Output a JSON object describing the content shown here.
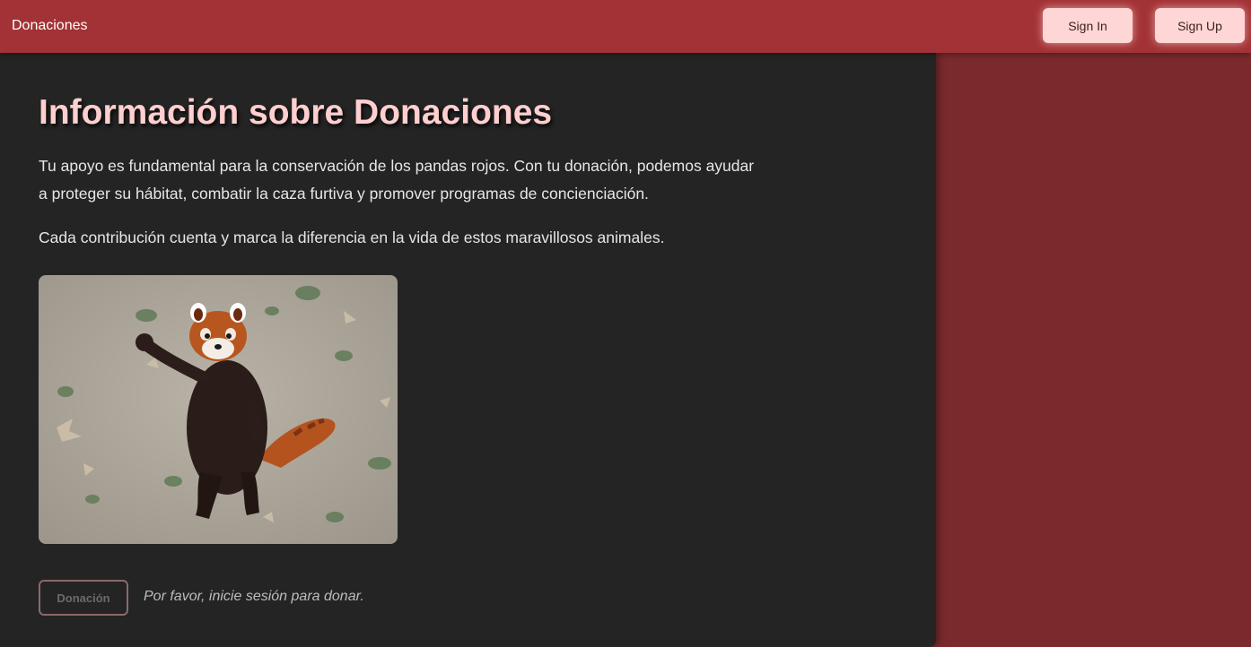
{
  "navbar": {
    "brand": "Donaciones",
    "sign_in_label": "Sign In",
    "sign_up_label": "Sign Up",
    "background_color": "#a23235"
  },
  "main": {
    "title": "Información sobre Donaciones",
    "paragraph_1": "Tu apoyo es fundamental para la conservación de los pandas rojos. Con tu donación, podemos ayudar a proteger su hábitat, combatir la caza furtiva y promover programas de concienciación.",
    "paragraph_2": "Cada contribución cuenta y marca la diferencia en la vida de estos maravillosos animales.",
    "image": {
      "icon": "red-panda-photo"
    },
    "donate_button_label": "Donación",
    "donate_button_disabled": true,
    "login_note": "Por favor, inicie sesión para donar."
  },
  "colors": {
    "accent": "#ffcfcf",
    "main_background": "#242424",
    "sidebar_background": "#7a2a2c"
  }
}
